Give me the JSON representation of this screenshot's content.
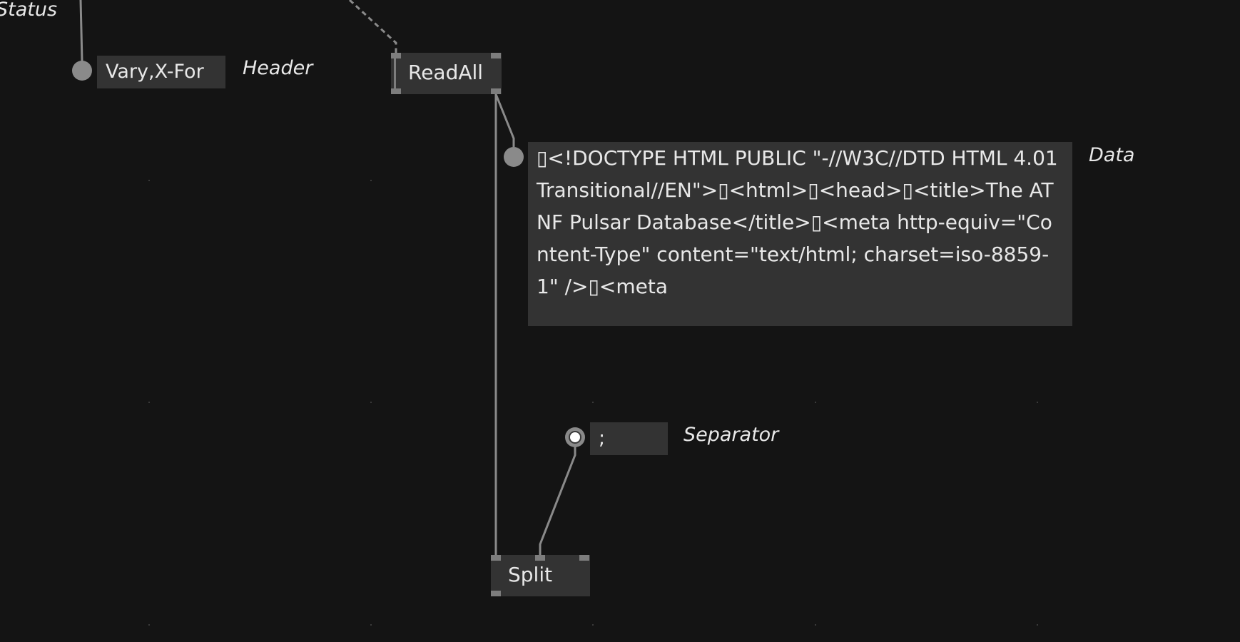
{
  "status_label": "Status",
  "header_pin": {
    "value": "Vary,X-For",
    "label": "Header"
  },
  "readall_node": {
    "title": "ReadAll"
  },
  "data_pin": {
    "value": "▯<!DOCTYPE HTML PUBLIC \"-//W3C//DTD HTML 4.01 Transitional//EN\">▯<html>▯<head>▯<title>The ATNF Pulsar Database</title>▯<meta http-equiv=\"Content-Type\" content=\"text/html; charset=iso-8859-1\" />▯<meta",
    "label": "Data"
  },
  "separator_pin": {
    "value": ";",
    "label": "Separator"
  },
  "split_node": {
    "title": "Split"
  },
  "colors": {
    "background": "#141414",
    "box": "#333333",
    "wire": "#8a8a8a",
    "text": "#e8e8e8"
  }
}
